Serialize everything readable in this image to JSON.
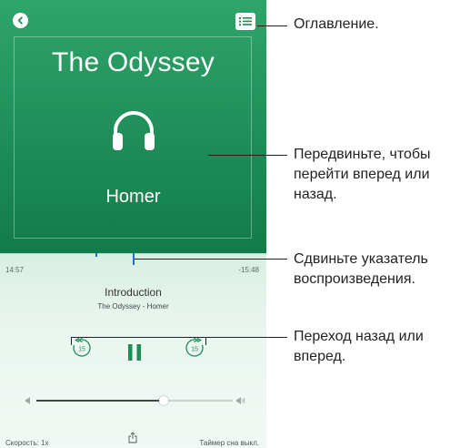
{
  "book": {
    "title": "The Odyssey",
    "author": "Homer"
  },
  "player": {
    "elapsed": "14:57",
    "remaining": "-15:48",
    "chapter": "Introduction",
    "subtitle": "The Odyssey - Homer",
    "skip_back_seconds": "15",
    "skip_forward_seconds": "15",
    "volume_fraction": 0.65,
    "speed_label": "Скорость: 1x",
    "sleep_timer_label": "Таймер сна выкл."
  },
  "callouts": {
    "toc": "Оглавление.",
    "swipe": "Передвиньте, чтобы перейти вперед или назад.",
    "scrubber": "Сдвиньте указатель воспроизведения.",
    "skip": "Переход назад или вперед."
  },
  "icons": {
    "back": "chevron-left-icon",
    "toc": "list-icon",
    "cover": "headphones-icon",
    "pause": "pause-icon",
    "share": "share-icon",
    "volume_low": "speaker-low-icon",
    "volume_high": "speaker-high-icon"
  },
  "colors": {
    "cover_green": "#1f8d58",
    "scrubber_blue": "#1f6fd6",
    "controls_bg": "#eaf6f0"
  }
}
